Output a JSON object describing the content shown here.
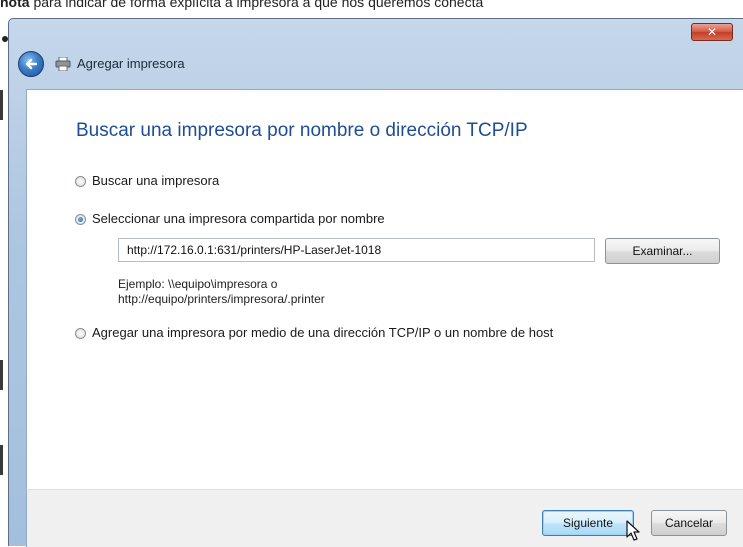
{
  "caption": {
    "bold": "nota",
    "text": "para indicar de forma explícita a impresora a que nos queremos conecta"
  },
  "window": {
    "title": "Agregar impresora",
    "close_glyph": "✕"
  },
  "main": {
    "heading": "Buscar una impresora por nombre o dirección TCP/IP",
    "options": [
      {
        "label": "Buscar una impresora",
        "checked": false
      },
      {
        "label": "Seleccionar una impresora compartida por nombre",
        "checked": true
      },
      {
        "label": "Agregar una impresora por medio de una dirección TCP/IP o un nombre de host",
        "checked": false
      }
    ],
    "printer_url": "http://172.16.0.1:631/printers/HP-LaserJet-1018",
    "browse_label": "Examinar...",
    "example_line1": "Ejemplo: \\\\equipo\\impresora o",
    "example_line2": "http://equipo/printers/impresora/.printer"
  },
  "footer": {
    "next_label": "Siguiente",
    "cancel_label": "Cancelar"
  },
  "icons": {
    "back": "back-arrow-icon",
    "printer": "printer-icon",
    "close": "close-icon",
    "cursor": "mouse-cursor-icon"
  },
  "colors": {
    "heading": "#1e4d96",
    "close_button": "#d45a45",
    "titlebar": "#adc6e2"
  }
}
